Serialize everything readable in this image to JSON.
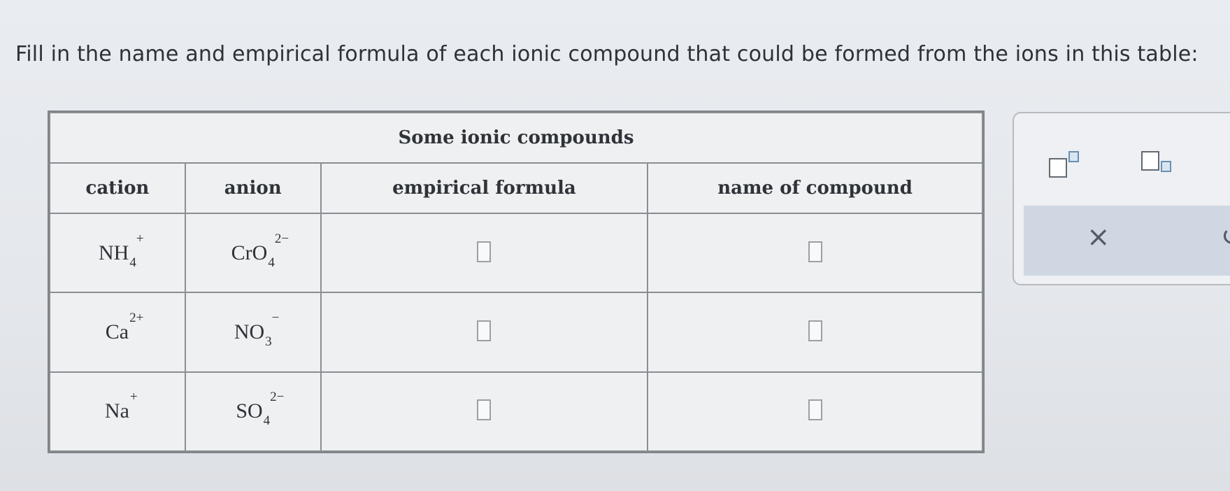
{
  "instruction": "Fill in the name and empirical formula of each ionic compound that could be formed from the ions in this table:",
  "table": {
    "caption": "Some ionic compounds",
    "headers": {
      "cation": "cation",
      "anion": "anion",
      "formula": "empirical formula",
      "name": "name of compound"
    },
    "rows": [
      {
        "cation": {
          "base": "NH",
          "sub": "4",
          "sup": "+"
        },
        "anion": {
          "base": "CrO",
          "sub": "4",
          "sup": "2−"
        },
        "formula_value": "",
        "name_value": ""
      },
      {
        "cation": {
          "base": "Ca",
          "sub": "",
          "sup": "2+"
        },
        "anion": {
          "base": "NO",
          "sub": "3",
          "sup": "−"
        },
        "formula_value": "",
        "name_value": ""
      },
      {
        "cation": {
          "base": "Na",
          "sub": "",
          "sup": "+"
        },
        "anion": {
          "base": "SO",
          "sub": "4",
          "sup": "2−"
        },
        "formula_value": "",
        "name_value": ""
      }
    ]
  },
  "toolbar": {
    "superscript_tool": "superscript-template-icon",
    "subscript_tool": "subscript-template-icon",
    "clear_label": "×",
    "undo_label": "↺"
  }
}
